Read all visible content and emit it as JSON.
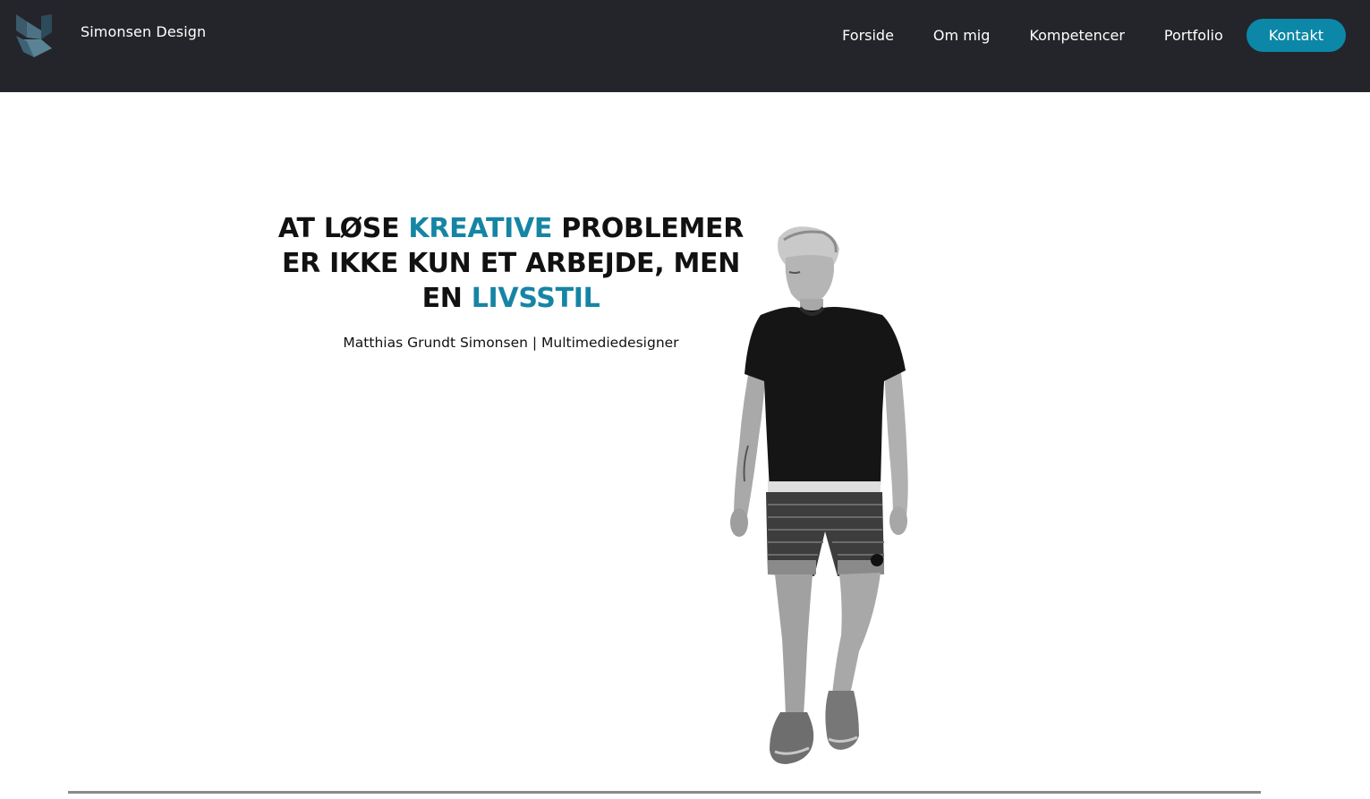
{
  "header": {
    "brand": "Simonsen Design",
    "logo_icon": "geometric-s-logo",
    "nav": [
      {
        "label": "Forside"
      },
      {
        "label": "Om mig"
      },
      {
        "label": "Kompetencer"
      },
      {
        "label": "Portfolio"
      },
      {
        "label": "Kontakt"
      }
    ]
  },
  "hero": {
    "line1": {
      "a": "AT LØSE ",
      "accent": "KREATIVE",
      "b": " PROBLEMER"
    },
    "line2": "ER IKKE KUN ET ARBEJDE, MEN",
    "line3": {
      "a": "EN ",
      "accent": "LIVSSTIL"
    },
    "subtitle": "Matthias Grundt Simonsen | Multimediedesigner"
  },
  "colors": {
    "navbar": "#24252a",
    "accent": "#1685a4",
    "cta": "#0c87a7",
    "text": "#111111",
    "divider": "#8a8a8a"
  }
}
